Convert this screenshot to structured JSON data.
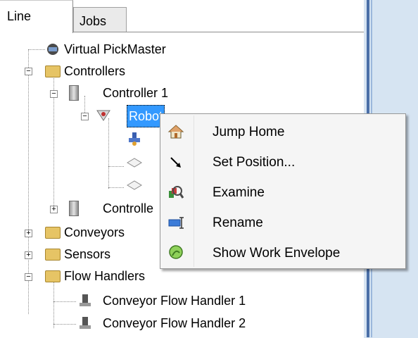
{
  "tabs": [
    {
      "label": "Line"
    },
    {
      "label": "Jobs"
    }
  ],
  "tree": {
    "virtual_pickmaster": "Virtual PickMaster",
    "controllers": "Controllers",
    "controller_1": "Controller 1",
    "robot": "Robot",
    "controller_2": "Controlle",
    "conveyors": "Conveyors",
    "sensors": "Sensors",
    "flow_handlers": "Flow Handlers",
    "flow_handler_1": "Conveyor Flow Handler 1",
    "flow_handler_2": "Conveyor Flow Handler 2"
  },
  "context_menu": {
    "items": [
      {
        "label": "Jump Home",
        "icon": "home-icon"
      },
      {
        "label": "Set Position...",
        "icon": "arrow-icon"
      },
      {
        "label": "Examine",
        "icon": "examine-icon"
      },
      {
        "label": "Rename",
        "icon": "rename-icon"
      },
      {
        "label": "Show Work Envelope",
        "icon": "work-envelope-icon"
      }
    ]
  }
}
